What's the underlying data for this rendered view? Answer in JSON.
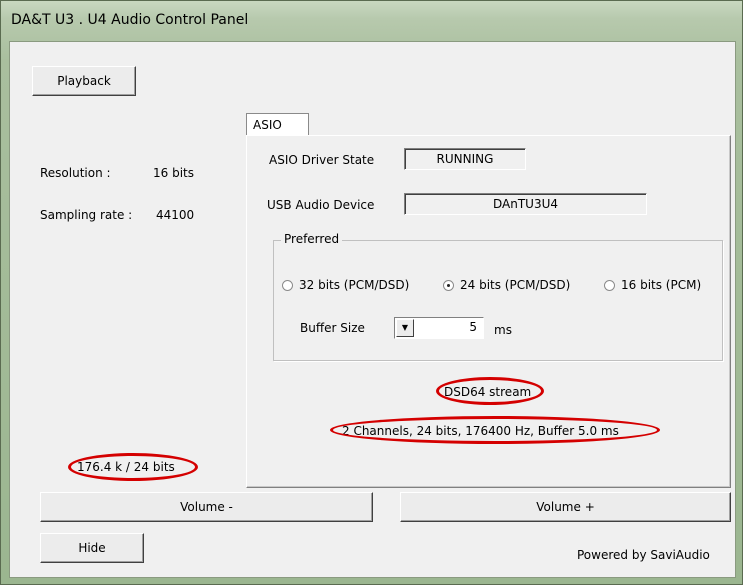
{
  "window": {
    "title": "DA&T U3 . U4 Audio Control Panel"
  },
  "left": {
    "playback_button": "Playback",
    "resolution_label": "Resolution :",
    "resolution_value": "16 bits",
    "sampling_label": "Sampling rate :",
    "sampling_value": "44100",
    "bottom_status": "176.4 k / 24 bits"
  },
  "tabs": [
    {
      "label": "ASIO",
      "selected": true
    }
  ],
  "asio": {
    "driver_state_label": "ASIO Driver State",
    "driver_state_value": "RUNNING",
    "usb_device_label": "USB Audio Device",
    "usb_device_value": "DAnTU3U4",
    "preferred_group": "Preferred",
    "options": [
      {
        "label": "32 bits (PCM/DSD)",
        "selected": false
      },
      {
        "label": "24 bits (PCM/DSD)",
        "selected": true
      },
      {
        "label": "16 bits (PCM)",
        "selected": false
      }
    ],
    "buffer_label": "Buffer Size",
    "buffer_value": "5",
    "buffer_unit": "ms",
    "stream_status": "DSD64 stream",
    "channel_status": "2 Channels, 24 bits, 176400 Hz, Buffer 5.0 ms"
  },
  "buttons": {
    "volume_down": "Volume -",
    "volume_up": "Volume +",
    "hide": "Hide"
  },
  "footer": {
    "powered_by": "Powered by SaviAudio"
  },
  "colors": {
    "highlight_ellipse": "#d40000"
  }
}
